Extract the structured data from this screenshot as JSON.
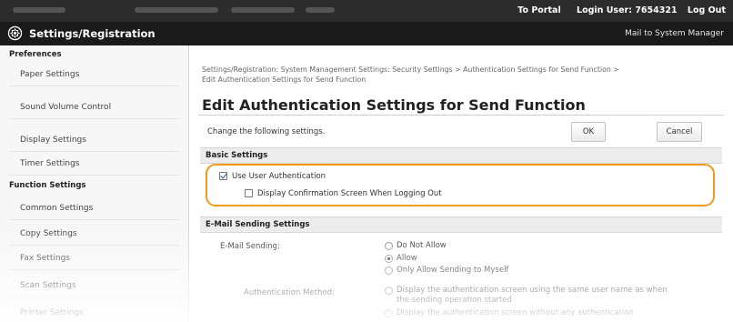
{
  "top_links": {
    "portal": "To Portal",
    "login_user": "Login User: 7654321",
    "logout": "Log Out"
  },
  "header": {
    "title": "Settings/Registration",
    "mail_link": "Mail to System Manager"
  },
  "sidebar": {
    "preferences_header": "Preferences",
    "preferences": [
      "Paper Settings",
      "Sound Volume Control",
      "Display Settings",
      "Timer Settings"
    ],
    "function_header": "Function Settings",
    "functions": [
      "Common Settings",
      "Copy Settings",
      "Fax Settings",
      "Scan Settings",
      "Printer Settings"
    ]
  },
  "main": {
    "breadcrumb_line1": "Settings/Registration: System Management Settings: Security Settings > Authentication Settings for Send Function >",
    "breadcrumb_line2": "Edit Authentication Settings for Send Function",
    "title": "Edit Authentication Settings for Send Function",
    "instruction": "Change the following settings.",
    "ok_label": "OK",
    "cancel_label": "Cancel",
    "basic": {
      "header": "Basic Settings",
      "use_user_auth": {
        "label": "Use User Authentication",
        "checked": true
      },
      "display_confirm": {
        "label": "Display Confirmation Screen When Logging Out",
        "checked": false
      }
    },
    "email": {
      "header": "E-Mail Sending Settings",
      "sending_label": "E-Mail Sending:",
      "options": [
        "Do Not Allow",
        "Allow",
        "Only Allow Sending to Myself"
      ],
      "selected": "Allow",
      "auth_method_label": "Authentication Method:",
      "auth_option1_line1": "Display the authentication screen using the same user name as when",
      "auth_option1_line2": "the sending operation started",
      "auth_option2": "Display the authentication screen without any authentication"
    }
  }
}
